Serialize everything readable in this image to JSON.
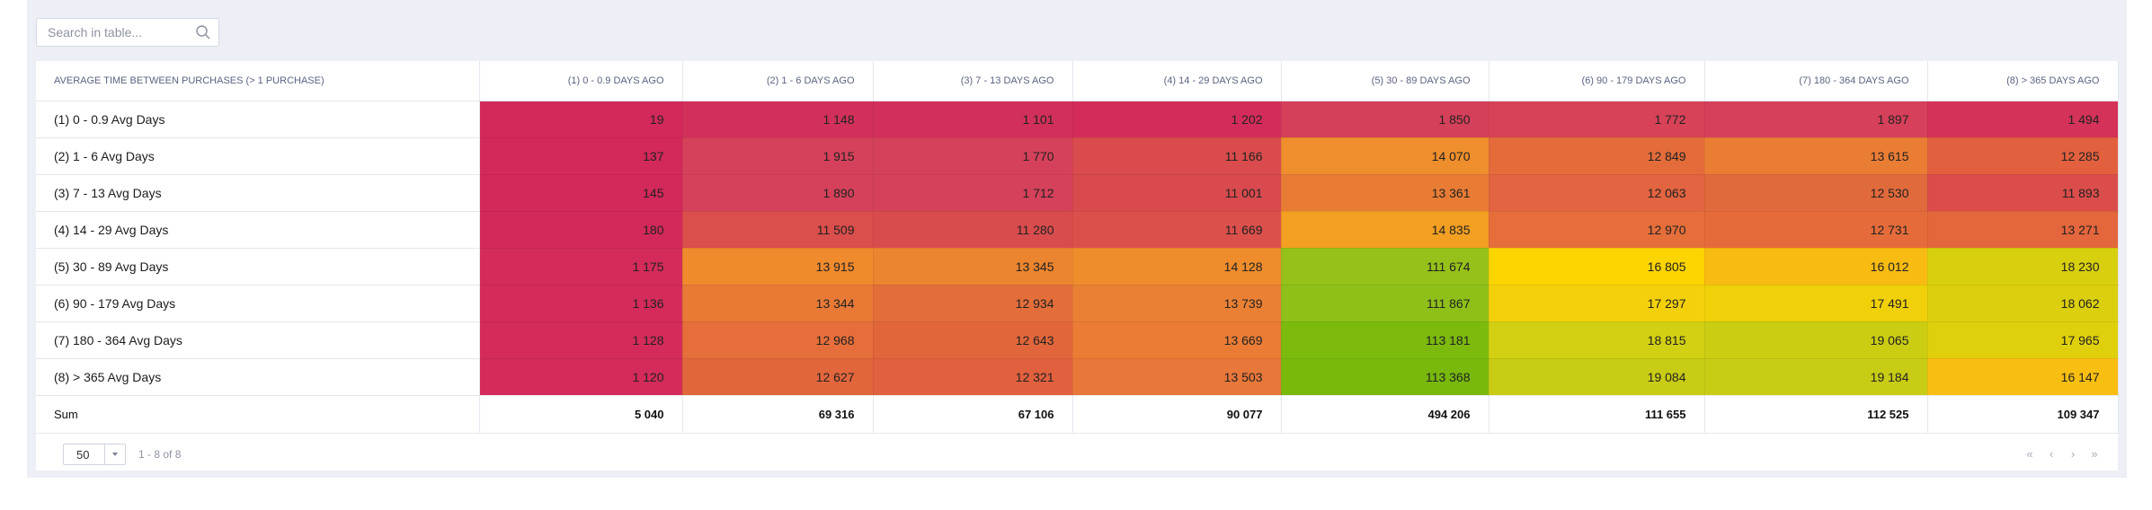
{
  "search": {
    "placeholder": "Search in table..."
  },
  "table": {
    "header_first": "Average time between purchases (> 1 purchase)",
    "columns": [
      "(1) 0 - 0.9 days ago",
      "(2) 1 - 6 days ago",
      "(3) 7 - 13 days ago",
      "(4) 14 - 29 days ago",
      "(5) 30 - 89 days ago",
      "(6) 90 - 179 days ago",
      "(7) 180 - 364 days ago",
      "(8) > 365 days ago"
    ],
    "rows": [
      {
        "label": "(1) 0 - 0.9 Avg Days",
        "values": [
          "19",
          "1 148",
          "1 101",
          "1 202",
          "1 850",
          "1 772",
          "1 897",
          "1 494"
        ],
        "colors": [
          "#d3285a",
          "#d2305b",
          "#d2305b",
          "#d42c5a",
          "#d4405a",
          "#d84258",
          "#d6405a",
          "#d43258"
        ]
      },
      {
        "label": "(2) 1 - 6 Avg Days",
        "values": [
          "137",
          "1 915",
          "1 770",
          "11 166",
          "14 070",
          "12 849",
          "13 615",
          "12 285"
        ],
        "colors": [
          "#d3285a",
          "#d5415a",
          "#d5415a",
          "#d94b4c",
          "#ef8e2c",
          "#e36c3a",
          "#ea7d34",
          "#e3603e"
        ]
      },
      {
        "label": "(3) 7 - 13 Avg Days",
        "values": [
          "145",
          "1 890",
          "1 712",
          "11 001",
          "13 361",
          "12 063",
          "12 530",
          "11 893"
        ],
        "colors": [
          "#d3285a",
          "#d5415a",
          "#d5415a",
          "#d84a4e",
          "#e97c35",
          "#e26440",
          "#e16a3c",
          "#db4d4b"
        ]
      },
      {
        "label": "(4) 14 - 29 Avg Days",
        "values": [
          "180",
          "11 509",
          "11 280",
          "11 669",
          "14 835",
          "12 970",
          "12 731",
          "13 271"
        ],
        "colors": [
          "#d3285a",
          "#da4e4c",
          "#d94c4d",
          "#dc504b",
          "#f29f22",
          "#e56e3a",
          "#e56c3a",
          "#e4663c"
        ]
      },
      {
        "label": "(5) 30 - 89 Avg Days",
        "values": [
          "1 175",
          "13 915",
          "13 345",
          "14 128",
          "111 674",
          "16 805",
          "16 012",
          "18 230"
        ],
        "colors": [
          "#d42b5a",
          "#ef8a2d",
          "#ec852f",
          "#ef8c2c",
          "#95c11a",
          "#fcd400",
          "#f8bb12",
          "#d8d00e"
        ]
      },
      {
        "label": "(6) 90 - 179 Avg Days",
        "values": [
          "1 136",
          "13 344",
          "12 934",
          "13 739",
          "111 867",
          "17 297",
          "17 491",
          "18 062"
        ],
        "colors": [
          "#d42b5a",
          "#e97a36",
          "#e46e3a",
          "#ea8034",
          "#8fc01a",
          "#f4d00a",
          "#f0d008",
          "#dccf0e"
        ]
      },
      {
        "label": "(7) 180 - 364 Avg Days",
        "values": [
          "1 128",
          "12 968",
          "12 643",
          "13 669",
          "113 181",
          "18 815",
          "19 065",
          "17 965"
        ],
        "colors": [
          "#d42b5a",
          "#e56e3a",
          "#e2663c",
          "#ea7c35",
          "#7cba0e",
          "#d2d012",
          "#cacd12",
          "#e0d00c"
        ]
      },
      {
        "label": "(8) > 365 Avg Days",
        "values": [
          "1 120",
          "12 627",
          "12 321",
          "13 503",
          "113 368",
          "19 084",
          "19 184",
          "16 147"
        ],
        "colors": [
          "#d42b5a",
          "#e2663c",
          "#e1603e",
          "#e8773a",
          "#78b90c",
          "#c9cc14",
          "#c8cc14",
          "#f9be12"
        ]
      }
    ],
    "sum": {
      "label": "Sum",
      "values": [
        "5 040",
        "69 316",
        "67 106",
        "90 077",
        "494 206",
        "111 655",
        "112 525",
        "109 347"
      ]
    }
  },
  "footer": {
    "page_size": "50",
    "range_text": "1 - 8 of 8",
    "pager": {
      "first": "«",
      "prev": "‹",
      "next": "›",
      "last": "»"
    }
  }
}
